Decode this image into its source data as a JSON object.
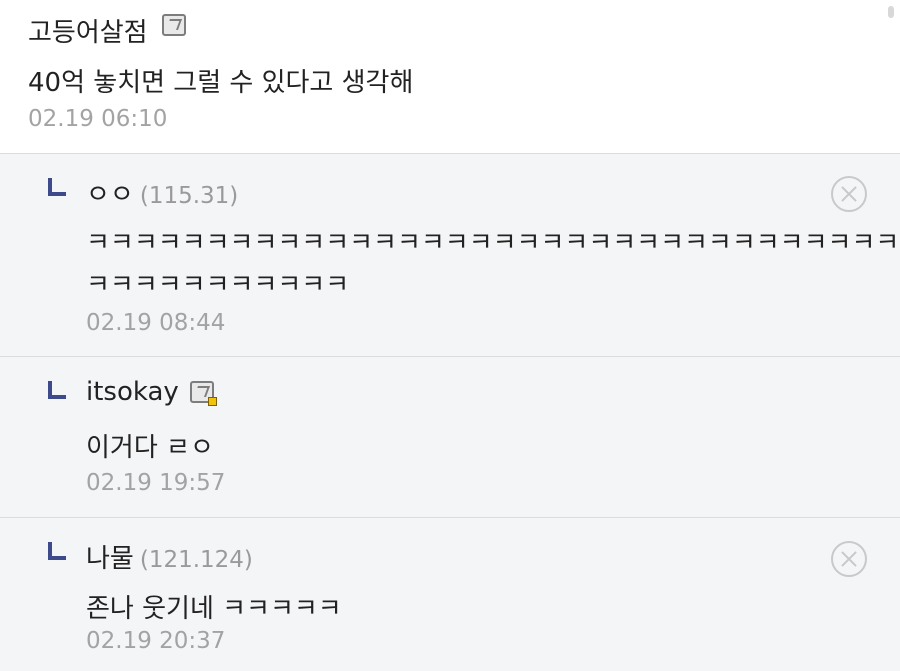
{
  "post": {
    "author": "고등어살점",
    "body": "40억 놓치면 그럴 수 있다고 생각해",
    "time": "02.19 06:10"
  },
  "replies": [
    {
      "author": "ㅇㅇ",
      "ip": "(115.31)",
      "body_lines": [
        "ㅋㅋㅋㅋㅋㅋㅋㅋㅋㅋㅋㅋㅋㅋㅋㅋㅋㅋㅋㅋㅋㅋㅋㅋㅋㅋㅋㅋㅋㅋㅋㅋㅋㅋㅋ",
        "ㅋㅋㅋㅋㅋㅋㅋㅋㅋㅋㅋ"
      ],
      "time": "02.19 08:44"
    },
    {
      "author": "itsokay",
      "body": "이거다 ㄹㅇ",
      "time": "02.19 19:57"
    },
    {
      "author": "나물",
      "ip": "(121.124)",
      "body": "존나 웃기네 ㅋㅋㅋㅋㅋ",
      "time": "02.19 20:37"
    }
  ],
  "icons": {
    "member": "member-badge-icon",
    "reply": "reply-arrow-icon",
    "delete": "delete-circle-x-icon"
  },
  "colors": {
    "reply_background": "#f4f5f7",
    "reply_arrow": "#3d4a8c",
    "timestamp": "#a3a3a3"
  }
}
